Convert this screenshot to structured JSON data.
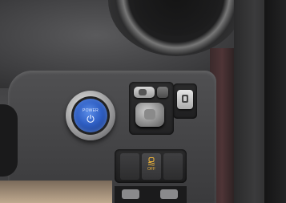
{
  "scene": {
    "power_button": {
      "label": "POWER",
      "color": "#2f5fc4"
    },
    "vsc_switch": {
      "label": "OFF",
      "icon": "skid-car-icon",
      "label_color": "#f0b53a"
    },
    "icons": {
      "power": "power-symbol-icon",
      "mirror_fold": "mirror-fold-icon"
    }
  }
}
